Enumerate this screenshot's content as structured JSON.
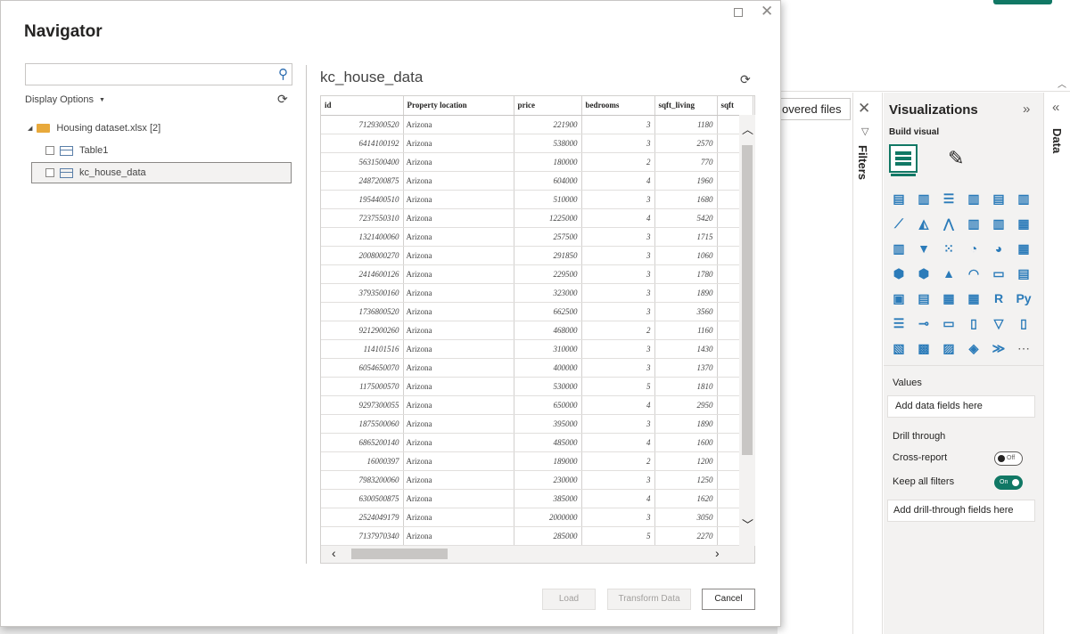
{
  "dialog": {
    "title": "Navigator",
    "search_placeholder": "",
    "display_options_label": "Display Options",
    "tree_root_label": "Housing dataset.xlsx [2]",
    "tree_items": [
      "Table1",
      "kc_house_data"
    ],
    "preview_title": "kc_house_data",
    "buttons": {
      "load": "Load",
      "transform": "Transform Data",
      "cancel": "Cancel"
    }
  },
  "table": {
    "columns": [
      "id",
      "Property location",
      "price",
      "bedrooms",
      "sqft_living",
      "sqft"
    ],
    "rows": [
      [
        "7129300520",
        "Arizona",
        "221900",
        "3",
        "1180"
      ],
      [
        "6414100192",
        "Arizona",
        "538000",
        "3",
        "2570"
      ],
      [
        "5631500400",
        "Arizona",
        "180000",
        "2",
        "770"
      ],
      [
        "2487200875",
        "Arizona",
        "604000",
        "4",
        "1960"
      ],
      [
        "1954400510",
        "Arizona",
        "510000",
        "3",
        "1680"
      ],
      [
        "7237550310",
        "Arizona",
        "1225000",
        "4",
        "5420"
      ],
      [
        "1321400060",
        "Arizona",
        "257500",
        "3",
        "1715"
      ],
      [
        "2008000270",
        "Arizona",
        "291850",
        "3",
        "1060"
      ],
      [
        "2414600126",
        "Arizona",
        "229500",
        "3",
        "1780"
      ],
      [
        "3793500160",
        "Arizona",
        "323000",
        "3",
        "1890"
      ],
      [
        "1736800520",
        "Arizona",
        "662500",
        "3",
        "3560"
      ],
      [
        "9212900260",
        "Arizona",
        "468000",
        "2",
        "1160"
      ],
      [
        "114101516",
        "Arizona",
        "310000",
        "3",
        "1430"
      ],
      [
        "6054650070",
        "Arizona",
        "400000",
        "3",
        "1370"
      ],
      [
        "1175000570",
        "Arizona",
        "530000",
        "5",
        "1810"
      ],
      [
        "9297300055",
        "Arizona",
        "650000",
        "4",
        "2950"
      ],
      [
        "1875500060",
        "Arizona",
        "395000",
        "3",
        "1890"
      ],
      [
        "6865200140",
        "Arizona",
        "485000",
        "4",
        "1600"
      ],
      [
        "16000397",
        "Arizona",
        "189000",
        "2",
        "1200"
      ],
      [
        "7983200060",
        "Arizona",
        "230000",
        "3",
        "1250"
      ],
      [
        "6300500875",
        "Arizona",
        "385000",
        "4",
        "1620"
      ],
      [
        "2524049179",
        "Arizona",
        "2000000",
        "3",
        "3050"
      ],
      [
        "7137970340",
        "Arizona",
        "285000",
        "5",
        "2270"
      ]
    ]
  },
  "background": {
    "discover_tab": "overed files",
    "filters_label": "Filters",
    "visualizations_title": "Visualizations",
    "build_visual": "Build visual",
    "values_label": "Values",
    "values_placeholder": "Add data fields here",
    "drill_through_label": "Drill through",
    "cross_report_label": "Cross-report",
    "cross_report_toggle": "Off",
    "keep_filters_label": "Keep all filters",
    "keep_filters_toggle": "On",
    "drill_placeholder": "Add drill-through fields here",
    "data_label": "Data",
    "viz_icons": [
      "stacked-bar-icon",
      "clustered-column-icon",
      "clustered-bar-icon",
      "stacked-column-icon",
      "100-bar-icon",
      "100-column-icon",
      "line-icon",
      "area-icon",
      "stacked-area-icon",
      "line-column-icon",
      "line-clustered-icon",
      "ribbon-icon",
      "waterfall-icon",
      "funnel-icon",
      "scatter-icon",
      "pie-icon",
      "donut-icon",
      "treemap-icon",
      "map-icon",
      "filled-map-icon",
      "azure-map-icon",
      "gauge-icon",
      "card-icon",
      "multi-row-card-icon",
      "kpi-icon",
      "slicer-icon",
      "table-icon",
      "matrix-icon",
      "r-visual-icon",
      "python-visual-icon",
      "key-influencers-icon",
      "decomposition-tree-icon",
      "qa-icon",
      "narrative-icon",
      "metrics-icon",
      "paginated-icon",
      "power-apps-icon",
      "power-automate-icon",
      "arcgis-icon",
      "custom-visual-icon",
      "more-visuals-icon",
      "more-icon"
    ],
    "viz_glyphs": [
      "▤",
      "▥",
      "☰",
      "▥",
      "▤",
      "▥",
      "⟋",
      "◭",
      "⋀",
      "▥",
      "▥",
      "▦",
      "▥",
      "▼",
      "⁙",
      "◔",
      "◕",
      "▦",
      "⬢",
      "⬢",
      "▲",
      "◠",
      "▭",
      "▤",
      "▣",
      "▤",
      "▦",
      "▦",
      "R",
      "Py",
      "☰",
      "⊸",
      "▭",
      "▯",
      "▽",
      "▯",
      "▧",
      "▩",
      "▨",
      "◈",
      "≫",
      "⋯"
    ]
  }
}
